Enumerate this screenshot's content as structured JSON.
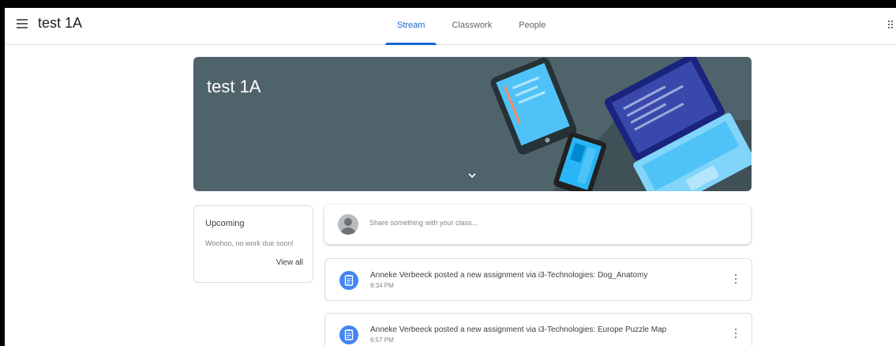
{
  "header": {
    "class_name": "test 1A",
    "tabs": [
      {
        "label": "Stream",
        "active": true
      },
      {
        "label": "Classwork",
        "active": false
      },
      {
        "label": "People",
        "active": false
      }
    ],
    "menu_icon": "hamburger-menu-icon",
    "apps_icon": "google-apps-icon"
  },
  "banner": {
    "title": "test 1A",
    "background_color": "#4f636b",
    "expand_icon": "chevron-down-icon"
  },
  "upcoming": {
    "title": "Upcoming",
    "message": "Woohoo, no work due soon!",
    "link": "View all"
  },
  "share": {
    "placeholder": "Share something with your class..."
  },
  "posts": [
    {
      "text": "Anneke Verbeeck posted a new assignment via i3-Technologies: Dog_Anatomy",
      "time": "8:34 PM",
      "icon": "assignment-icon"
    },
    {
      "text": "Anneke Verbeeck posted a new assignment via i3-Technologies: Europe Puzzle Map",
      "time": "6:57 PM",
      "icon": "assignment-icon"
    }
  ],
  "colors": {
    "accent": "#1967d2",
    "assignment": "#4285f4"
  }
}
